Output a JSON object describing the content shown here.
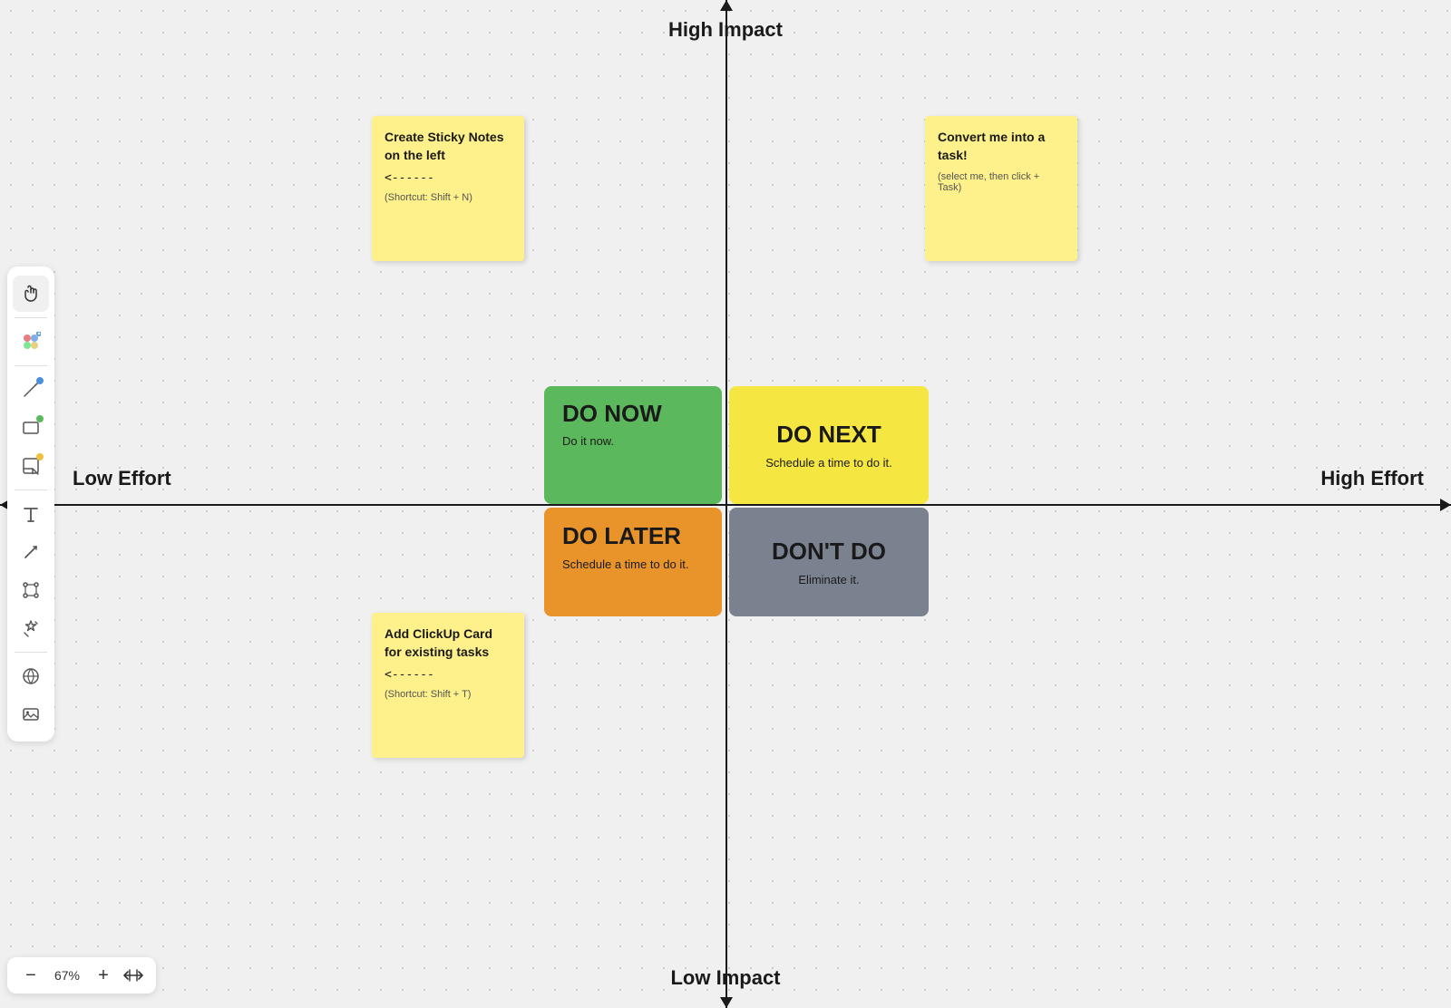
{
  "canvas": {
    "background": "#f0f0f0"
  },
  "toolbar": {
    "items": [
      {
        "name": "hand-tool",
        "icon": "✋",
        "active": true
      },
      {
        "name": "shape-tool",
        "icon": "✦",
        "active": false,
        "color": true
      },
      {
        "name": "pen-tool",
        "icon": "✏",
        "active": false,
        "dot": "blue"
      },
      {
        "name": "rect-tool",
        "icon": "□",
        "active": false,
        "dot": "green"
      },
      {
        "name": "sticky-tool",
        "icon": "🗒",
        "active": false,
        "dot": "yellow"
      },
      {
        "name": "text-tool",
        "icon": "T",
        "active": false
      },
      {
        "name": "line-tool",
        "icon": "↗",
        "active": false
      },
      {
        "name": "connect-tool",
        "icon": "⬡",
        "active": false
      },
      {
        "name": "magic-tool",
        "icon": "✦",
        "active": false
      },
      {
        "name": "globe-tool",
        "icon": "🌐",
        "active": false
      },
      {
        "name": "image-tool",
        "icon": "🖼",
        "active": false
      }
    ]
  },
  "axes": {
    "top_label": "High Impact",
    "bottom_label": "Low Impact",
    "left_label": "Low Effort",
    "right_label": "High Effort"
  },
  "quadrants": {
    "do_now": {
      "title": "DO NOW",
      "subtitle": "Do it now."
    },
    "do_next": {
      "title": "DO NEXT",
      "subtitle": "Schedule a time to do it."
    },
    "do_later": {
      "title": "DO LATER",
      "subtitle": "Schedule a time to do it."
    },
    "dont_do": {
      "title": "DON'T DO",
      "subtitle": "Eliminate it."
    }
  },
  "sticky_notes": {
    "top_left": {
      "title": "Create Sticky Notes on the left",
      "arrow": "<------",
      "shortcut": "(Shortcut: Shift + N)"
    },
    "top_right": {
      "title": "Convert me into a task!",
      "body": "(select me, then click + Task)"
    },
    "bottom_left": {
      "title": "Add ClickUp Card for existing tasks",
      "arrow": "<------",
      "shortcut": "(Shortcut: Shift + T)"
    }
  },
  "zoom": {
    "level": "67%",
    "minus": "−",
    "plus": "+",
    "fit": "↔"
  }
}
